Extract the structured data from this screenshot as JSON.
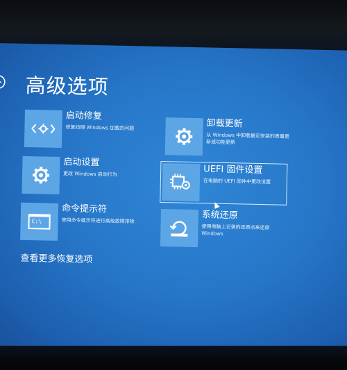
{
  "page": {
    "title": "高级选项"
  },
  "tiles": [
    {
      "title": "启动修复",
      "desc": "修复妨碍 Windows 加载的问题",
      "icon": "diagnose-icon"
    },
    {
      "title": "卸载更新",
      "desc_1": "从 Windows 中卸载最近安装的质量更",
      "desc_2": "新或功能更新",
      "icon": "gear-icon"
    },
    {
      "title": "启动设置",
      "desc": "更改 Windows 启动行为",
      "icon": "gear-icon"
    },
    {
      "title": "UEFI 固件设置",
      "desc": "在电脑的 UEFI 固件中更改设置",
      "icon": "chip-gear-icon"
    },
    {
      "title": "命令提示符",
      "desc": "使用命令提示符进行高级故障排除",
      "icon": "command-prompt-icon",
      "prompt": "C:\\"
    },
    {
      "title": "系统还原",
      "desc_1": "使用电脑上记录的还原点来还原",
      "desc_2": "Windows",
      "icon": "restore-icon"
    }
  ],
  "more": {
    "label": "查看更多恢复选项"
  },
  "colors": {
    "background": "#2777c9",
    "tile": "#5da6e6",
    "text": "#ffffff"
  }
}
